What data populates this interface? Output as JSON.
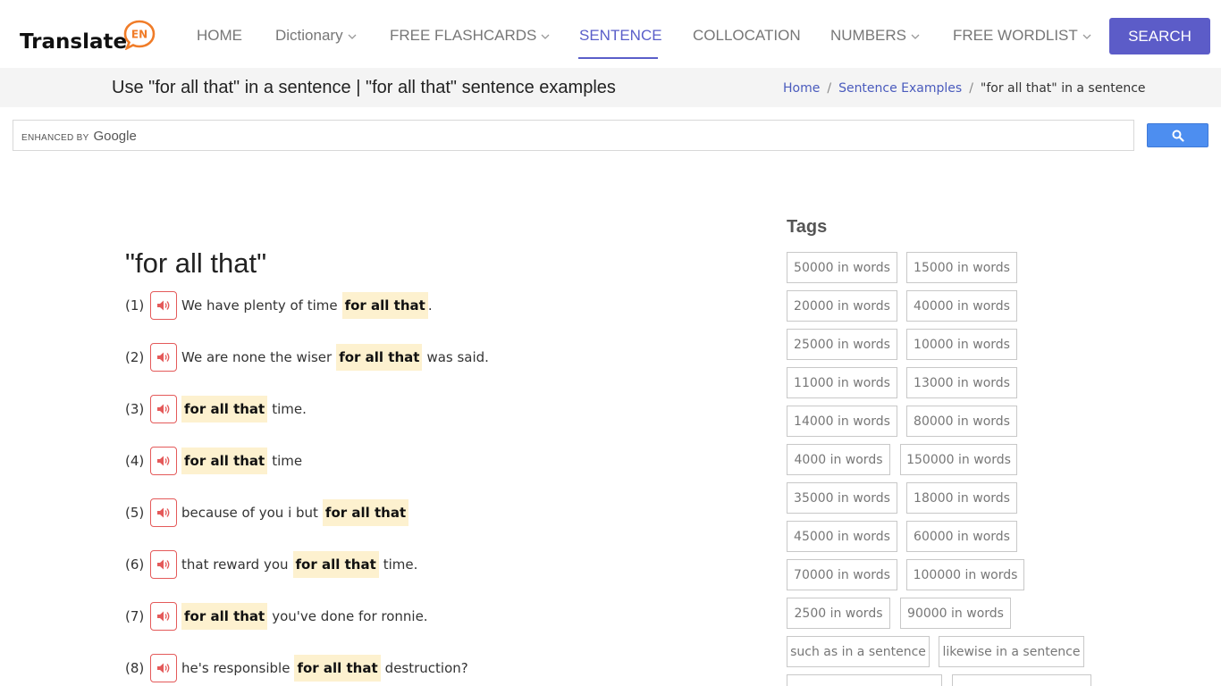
{
  "header": {
    "logo_text": "Translate",
    "logo_badge": "EN",
    "nav": [
      {
        "label": "HOME",
        "dropdown": false,
        "active": false
      },
      {
        "label": "Dictionary",
        "dropdown": true,
        "active": false
      },
      {
        "label": "FREE FLASHCARDS",
        "dropdown": true,
        "active": false
      },
      {
        "label": "SENTENCE",
        "dropdown": false,
        "active": true
      },
      {
        "label": "COLLOCATION",
        "dropdown": false,
        "active": false
      },
      {
        "label": "NUMBERS",
        "dropdown": true,
        "active": false
      },
      {
        "label": "FREE WORDLIST",
        "dropdown": true,
        "active": false
      }
    ],
    "search_label": "SEARCH"
  },
  "titlebar": {
    "title": "Use \"for all that\" in a sentence | \"for all that\" sentence examples",
    "breadcrumb": [
      {
        "label": "Home",
        "link": true
      },
      {
        "label": "Sentence Examples",
        "link": true
      },
      {
        "label": "\"for all that\" in a sentence",
        "link": false
      }
    ]
  },
  "google_search": {
    "enhanced_by": "ENHANCED BY",
    "brand": "Google"
  },
  "main": {
    "heading": "\"for all that\"",
    "sentences": [
      {
        "num": "(1)",
        "before": "We have plenty of time",
        "phrase": "for all that",
        "after": "."
      },
      {
        "num": "(2)",
        "before": "We are none the wiser",
        "phrase": "for all that",
        "after": "was said."
      },
      {
        "num": "(3)",
        "before": "",
        "phrase": "for all that",
        "after": "time."
      },
      {
        "num": "(4)",
        "before": "",
        "phrase": "for all that",
        "after": "time"
      },
      {
        "num": "(5)",
        "before": "because of you i but",
        "phrase": "for all that",
        "after": ""
      },
      {
        "num": "(6)",
        "before": "that reward you",
        "phrase": "for all that",
        "after": "time."
      },
      {
        "num": "(7)",
        "before": "",
        "phrase": "for all that",
        "after": "you've done for ronnie."
      },
      {
        "num": "(8)",
        "before": "he's responsible",
        "phrase": "for all that",
        "after": "destruction?"
      }
    ]
  },
  "tags": {
    "title": "Tags",
    "items": [
      "50000 in words",
      "15000 in words",
      "20000 in words",
      "40000 in words",
      "25000 in words",
      "10000 in words",
      "11000 in words",
      "13000 in words",
      "14000 in words",
      "80000 in words",
      "4000 in words",
      "150000 in words",
      "35000 in words",
      "18000 in words",
      "45000 in words",
      "60000 in words",
      "70000 in words",
      "100000 in words",
      "2500 in words",
      "90000 in words",
      "such as in a sentence",
      "likewise in a sentence"
    ]
  },
  "colors": {
    "accent": "#5c5cc8",
    "highlight": "#fdf1cf",
    "audio_border": "#e45a5a",
    "logo_orange": "#f07c28"
  }
}
